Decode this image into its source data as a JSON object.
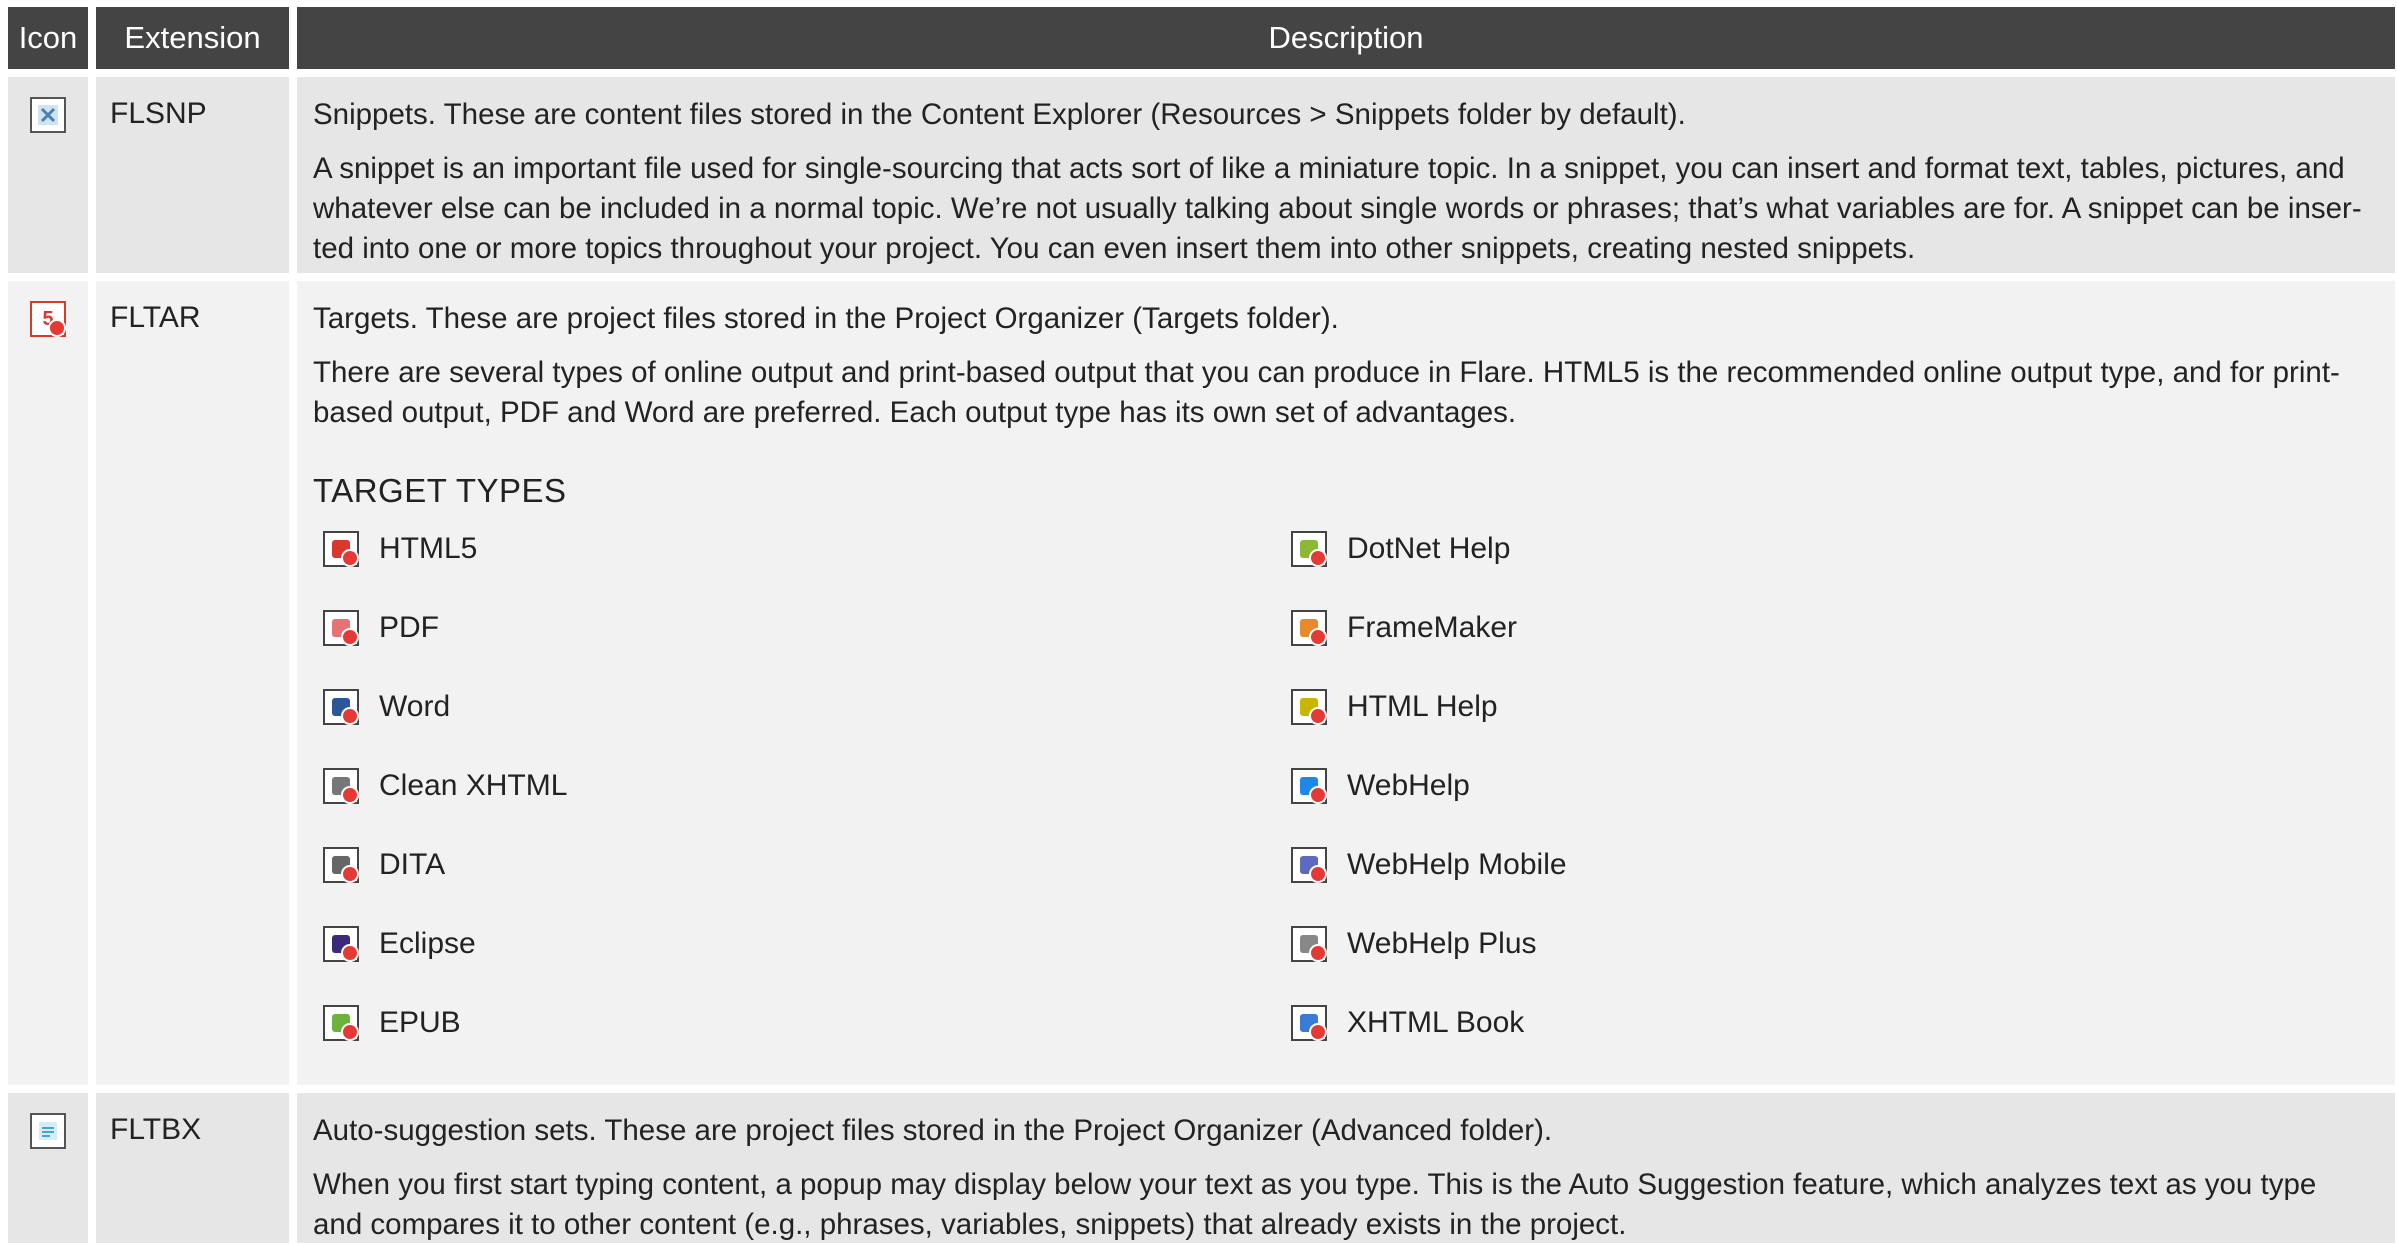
{
  "table": {
    "headers": {
      "icon": "Icon",
      "extension": "Extension",
      "description": "Description"
    },
    "rows": [
      {
        "icon": "snippet-file-icon",
        "extension": "FLSNP",
        "paragraphs": [
          "Snippets. These are content files stored in the Content Explorer (Resources > Snippets folder by default).",
          "A snippet is an important file used for single-sourcing that acts sort of like a miniature topic. In a snippet, you can insert and format text, tables, pictures, and whatever else can be included in a normal topic. We’re not usually talking about single words or phrases; that’s what variables are for. A snippet can be inser-ted into one or more topics throughout your project. You can even insert them into other snippets, creating nested snippets."
        ]
      },
      {
        "icon": "target-file-icon",
        "extension": "FLTAR",
        "paragraphs": [
          "Targets. These are project files stored in the Project Organizer (Targets folder).",
          "There are several types of online output and print-based output that you can produce in Flare. HTML5 is the recommended online output type, and for print-based output, PDF and Word are preferred. Each output type has its own set of advantages."
        ],
        "section_title": "TARGET TYPES",
        "target_types": [
          {
            "label": "HTML5",
            "icon": "html5-target-icon",
            "color": "#d9382b"
          },
          {
            "label": "DotNet Help",
            "icon": "dotnet-help-target-icon",
            "color": "#8db833"
          },
          {
            "label": "PDF",
            "icon": "pdf-target-icon",
            "color": "#e57373"
          },
          {
            "label": "FrameMaker",
            "icon": "framemaker-target-icon",
            "color": "#e8892b"
          },
          {
            "label": "Word",
            "icon": "word-target-icon",
            "color": "#2b579a"
          },
          {
            "label": "HTML Help",
            "icon": "html-help-target-icon",
            "color": "#c9b600"
          },
          {
            "label": "Clean XHTML",
            "icon": "clean-xhtml-target-icon",
            "color": "#777777"
          },
          {
            "label": "WebHelp",
            "icon": "webhelp-target-icon",
            "color": "#1e88e5"
          },
          {
            "label": "DITA",
            "icon": "dita-target-icon",
            "color": "#666666"
          },
          {
            "label": "WebHelp Mobile",
            "icon": "webhelp-mobile-target-icon",
            "color": "#5c6bc0"
          },
          {
            "label": "Eclipse",
            "icon": "eclipse-target-icon",
            "color": "#3b2a7a"
          },
          {
            "label": "WebHelp Plus",
            "icon": "webhelp-plus-target-icon",
            "color": "#888888"
          },
          {
            "label": "EPUB",
            "icon": "epub-target-icon",
            "color": "#6cb33e"
          },
          {
            "label": "XHTML Book",
            "icon": "xhtml-book-target-icon",
            "color": "#3a7bd5"
          }
        ]
      },
      {
        "icon": "auto-suggestion-file-icon",
        "extension": "FLTBX",
        "paragraphs": [
          "Auto-suggestion sets. These are project files stored in the Project Organizer (Advanced folder).",
          "When you first start typing content, a popup may display below your text as you type. This is the Auto Suggestion feature, which analyzes text as you type and compares it to other content (e.g., phrases, variables, snippets) that already exists in the project."
        ]
      }
    ]
  }
}
